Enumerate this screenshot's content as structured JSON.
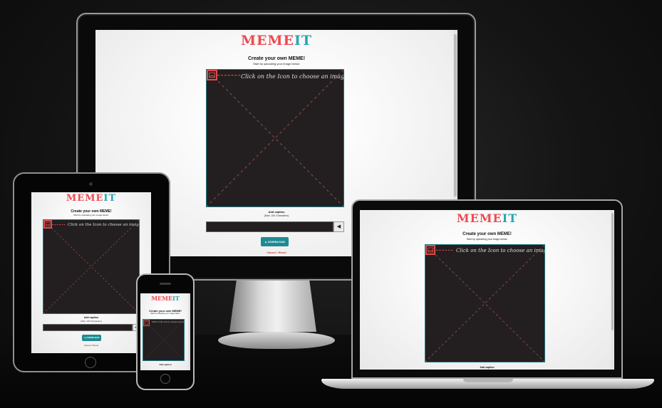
{
  "app": {
    "logo_part1": "MEME",
    "logo_part2": "IT",
    "heading": "Create your own MEME!",
    "subheading": "Start by uploading your image below:",
    "choose_hint": "Click on the Icon to choose an image!",
    "caption_label": "Add caption",
    "caption_max": "(Max: 100 Characters)",
    "caption_value": "",
    "caption_submit_glyph": "◀",
    "download_label": "DOWNLOAD",
    "download_icon": "download-icon",
    "reset_label": "Cancel / Reset"
  },
  "devices": [
    "desktop-monitor",
    "laptop",
    "tablet",
    "phone"
  ],
  "colors": {
    "logo_primary": "#ec4b51",
    "logo_accent": "#27a7b2",
    "canvas_bg": "#231f20",
    "download_bg": "#1f8b93",
    "reset_text": "#d23c3c"
  }
}
